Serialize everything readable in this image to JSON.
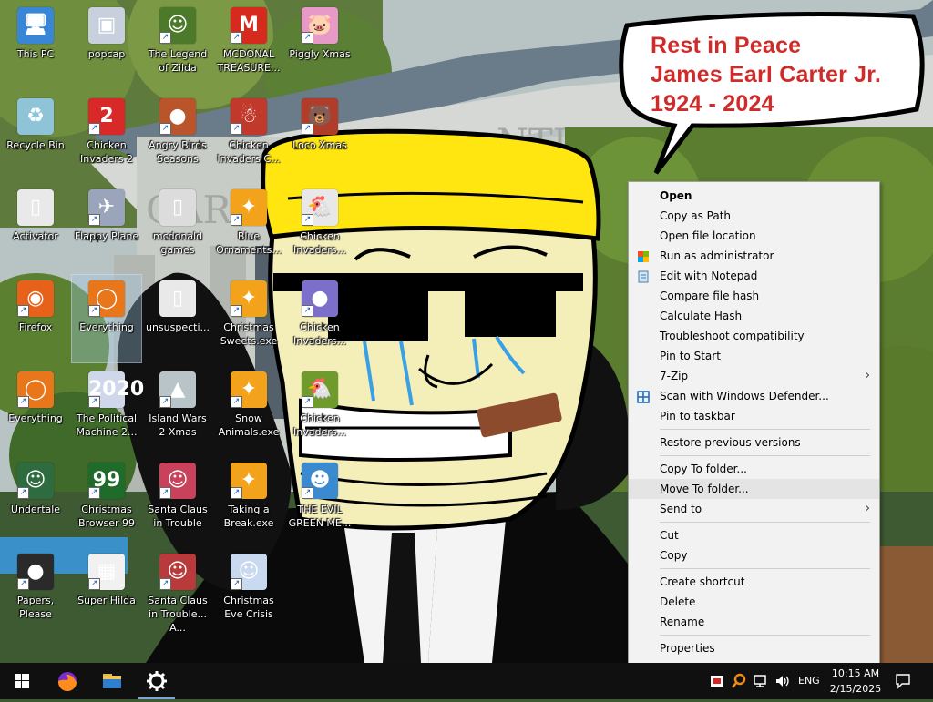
{
  "bubble": {
    "line1": "Rest in Peace",
    "line2": "James Earl Carter Jr.",
    "line3": "1924 - 2024"
  },
  "wallpaper": {
    "sign_text": "CARTER",
    "sign_text2": "NTIAL"
  },
  "desktop_icons": [
    {
      "label": "This PC",
      "icon": "this-pc-icon",
      "color": "#3a86d6",
      "glyph": "🖥",
      "shortcut": false
    },
    {
      "label": "popcap",
      "icon": "popcap-icon",
      "color": "#c9d0dd",
      "glyph": "▣",
      "shortcut": false
    },
    {
      "label": "The Legend of Zilda",
      "icon": "legend-of-zilda-icon",
      "color": "#4d7a2a",
      "glyph": "☺",
      "shortcut": true
    },
    {
      "label": "MCDONAL TREASURE...",
      "icon": "mcdonald-treasure-icon",
      "color": "#d72a1f",
      "glyph": "M",
      "shortcut": true
    },
    {
      "label": "Piggly Xmas",
      "icon": "piggly-xmas-icon",
      "color": "#e79ac8",
      "glyph": "🐷",
      "shortcut": true
    },
    {
      "label": "Recycle Bin",
      "icon": "recycle-bin-icon",
      "color": "#8fc3d8",
      "glyph": "♻",
      "shortcut": false
    },
    {
      "label": "Chicken Invaders 2",
      "icon": "chicken-invaders-2-icon",
      "color": "#d82828",
      "glyph": "2",
      "shortcut": true
    },
    {
      "label": "Angry Birds Seasons",
      "icon": "angry-birds-seasons-icon",
      "color": "#b9542b",
      "glyph": "●",
      "shortcut": true
    },
    {
      "label": "Chicken Invaders C...",
      "icon": "chicken-invaders-c-icon",
      "color": "#c0392b",
      "glyph": "☃",
      "shortcut": true
    },
    {
      "label": "Loco Xmas",
      "icon": "loco-xmas-icon",
      "color": "#b23c2a",
      "glyph": "🐻",
      "shortcut": true
    },
    {
      "label": "Activator",
      "icon": "activator-icon",
      "color": "#e9e9e9",
      "glyph": "▯",
      "shortcut": false
    },
    {
      "label": "Flappy Plane",
      "icon": "flappy-plane-icon",
      "color": "#9aa4ba",
      "glyph": "✈",
      "shortcut": true
    },
    {
      "label": "mcdonald games",
      "icon": "folder-icon",
      "color": "#dcdcdc",
      "glyph": "▯",
      "shortcut": false
    },
    {
      "label": "Blue Ornaments...",
      "icon": "blue-ornaments-icon",
      "color": "#f2a31b",
      "glyph": "✦",
      "shortcut": true
    },
    {
      "label": "Chicken Invaders...",
      "icon": "chicken-invaders-icon",
      "color": "#e8e8e8",
      "glyph": "🐔",
      "shortcut": true
    },
    {
      "label": "Firefox",
      "icon": "firefox-icon",
      "color": "#e8611a",
      "glyph": "◉",
      "shortcut": true
    },
    {
      "label": "Everything",
      "icon": "everything-icon",
      "color": "#e8761a",
      "glyph": "◯",
      "shortcut": true
    },
    {
      "label": "unsuspecti...",
      "icon": "file-icon",
      "color": "#e9e9e9",
      "glyph": "▯",
      "shortcut": false
    },
    {
      "label": "Christmas Sweets.exe",
      "icon": "christmas-sweets-icon",
      "color": "#f2a31b",
      "glyph": "✦",
      "shortcut": true
    },
    {
      "label": "Chicken Invaders...",
      "icon": "chicken-invaders-3-icon",
      "color": "#7c6fc9",
      "glyph": "●",
      "shortcut": true
    },
    {
      "label": "Everything",
      "icon": "everything-icon",
      "color": "#e8761a",
      "glyph": "◯",
      "shortcut": true
    },
    {
      "label": "The Political Machine 2...",
      "icon": "political-machine-icon",
      "color": "#cfd7ea",
      "glyph": "2020",
      "shortcut": true
    },
    {
      "label": "Island Wars 2 Xmas",
      "icon": "island-wars-icon",
      "color": "#b9c4c9",
      "glyph": "▲",
      "shortcut": true
    },
    {
      "label": "Snow Animals.exe",
      "icon": "snow-animals-icon",
      "color": "#f2a31b",
      "glyph": "✦",
      "shortcut": true
    },
    {
      "label": "Chicken Invaders...",
      "icon": "chicken-invaders-4-icon",
      "color": "#6f9a2c",
      "glyph": "🐔",
      "shortcut": true
    },
    {
      "label": "Undertale",
      "icon": "undertale-icon",
      "color": "#2e6b3f",
      "glyph": "☺",
      "shortcut": true
    },
    {
      "label": "Christmas Browser 99",
      "icon": "christmas-browser-icon",
      "color": "#1f6b2a",
      "glyph": "99",
      "shortcut": true
    },
    {
      "label": "Santa Claus in Trouble",
      "icon": "santa-claus-trouble-icon",
      "color": "#c9425b",
      "glyph": "☺",
      "shortcut": true
    },
    {
      "label": "Taking a Break.exe",
      "icon": "taking-a-break-icon",
      "color": "#f2a31b",
      "glyph": "✦",
      "shortcut": true
    },
    {
      "label": "THE EVIL GREEN ME...",
      "icon": "evil-green-messenger-icon",
      "color": "#3b8ad0",
      "glyph": "☻",
      "shortcut": true
    },
    {
      "label": "Papers, Please",
      "icon": "papers-please-icon",
      "color": "#2a2a2a",
      "glyph": "●",
      "shortcut": true
    },
    {
      "label": "Super Hilda",
      "icon": "super-hilda-icon",
      "color": "#f1f1f1",
      "glyph": "▦",
      "shortcut": true
    },
    {
      "label": "Santa Claus in Trouble... A...",
      "icon": "santa-claus-trouble-2-icon",
      "color": "#b83a3a",
      "glyph": "☺",
      "shortcut": true
    },
    {
      "label": "Christmas Eve Crisis",
      "icon": "christmas-eve-crisis-icon",
      "color": "#c9d9ef",
      "glyph": "☺",
      "shortcut": true
    }
  ],
  "context_menu": {
    "items": [
      {
        "label": "Open",
        "bold": true
      },
      {
        "label": "Copy as Path"
      },
      {
        "label": "Open file location"
      },
      {
        "label": "Run as administrator",
        "icon": "shield-icon"
      },
      {
        "label": "Edit with Notepad",
        "icon": "notepad-icon"
      },
      {
        "label": "Compare file hash"
      },
      {
        "label": "Calculate Hash"
      },
      {
        "label": "Troubleshoot compatibility"
      },
      {
        "label": "Pin to Start"
      },
      {
        "label": "7-Zip",
        "submenu": true
      },
      {
        "label": "Scan with Windows Defender...",
        "icon": "windows-defender-icon"
      },
      {
        "label": "Pin to taskbar"
      },
      {
        "label": "Restore previous versions"
      },
      {
        "label": "Copy To folder..."
      },
      {
        "label": "Move To folder...",
        "highlighted": true
      },
      {
        "label": "Send to",
        "submenu": true
      },
      {
        "label": "Cut"
      },
      {
        "label": "Copy"
      },
      {
        "label": "Create shortcut"
      },
      {
        "label": "Delete"
      },
      {
        "label": "Rename"
      },
      {
        "label": "Properties"
      }
    ],
    "submenu_glyph": "›"
  },
  "taskbar": {
    "pinned": [
      {
        "name": "start-button",
        "icon": "windows-icon"
      },
      {
        "name": "firefox-taskbar-button",
        "icon": "firefox-icon"
      },
      {
        "name": "file-explorer-taskbar-button",
        "icon": "folder-icon"
      },
      {
        "name": "settings-taskbar-button",
        "icon": "gear-icon",
        "active": true
      }
    ],
    "tray": {
      "language": "ENG",
      "time": "10:15 AM",
      "date": "2/15/2025"
    }
  }
}
